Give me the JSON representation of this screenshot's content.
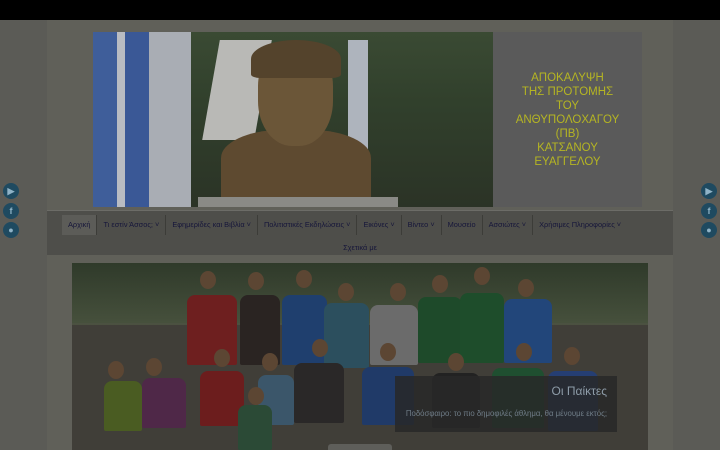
{
  "banner": {
    "panel_text": "ΑΠΟΚΑΛΥΨΗ\nΤΗΣ ΠΡΟΤΟΜΗΣ\nΤΟΥ\nΑΝΘΥΠΟΛΟΧΑΓΟΥ\n(ΠΒ)\nΚΑΤΣΑΝΟΥ\nΕΥΑΓΓΕΛΟΥ",
    "panel_text_color": "#b5b523"
  },
  "social_left": [
    "youtube-icon",
    "facebook-icon",
    "user-icon"
  ],
  "social_right": [
    "youtube-icon",
    "facebook-icon",
    "user-icon"
  ],
  "social_glyphs": {
    "youtube": "▶",
    "facebook": "f",
    "user": "●"
  },
  "nav": {
    "items": [
      {
        "label": "Αρχική"
      },
      {
        "label": "Τι εστίν Άσσος; ˅"
      },
      {
        "label": "Εφημερίδες και Βιβλία ˅"
      },
      {
        "label": "Πολιτιστικές Εκδηλώσεις ˅"
      },
      {
        "label": "Εικόνες ˅"
      },
      {
        "label": "Βίντεο ˅"
      },
      {
        "label": "Μουσείο"
      },
      {
        "label": "Ασσιώτες ˅"
      },
      {
        "label": "Χρήσιμες Πληροφορίες ˅"
      }
    ],
    "second_row": "Σχετικά με"
  },
  "slider": {
    "caption_title": "Οι Παίκτες",
    "caption_text": "Ποδόσφαιρο: το πιο δημοφιλές άθλημα, θα μένουμε εκτός;"
  }
}
